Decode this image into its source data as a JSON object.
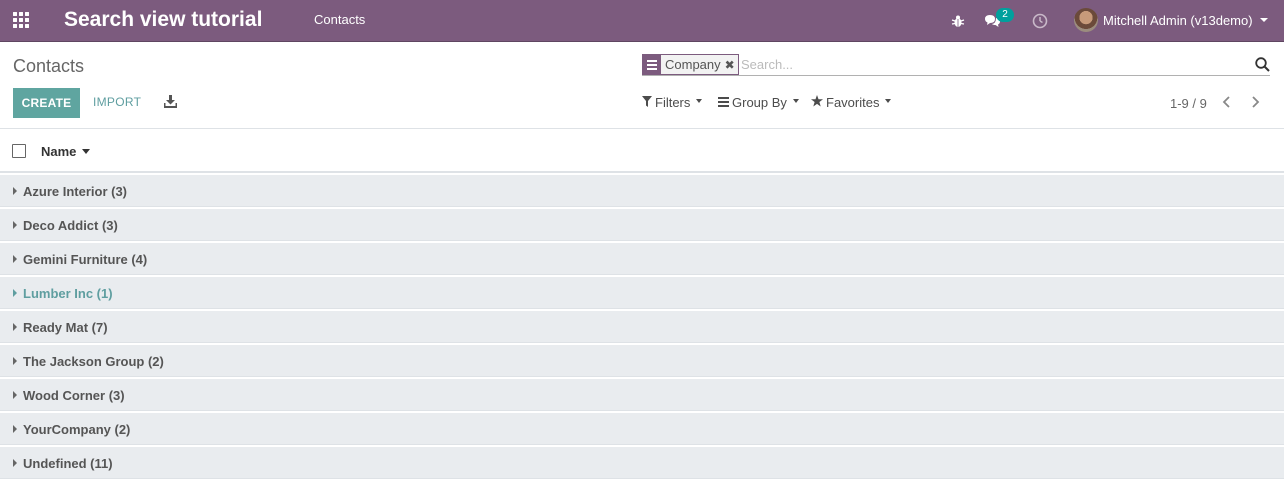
{
  "navbar": {
    "app_title": "Search view tutorial",
    "menu_item": "Contacts",
    "chat_badge": "2",
    "user_name": "Mitchell Admin (v13demo)"
  },
  "control_panel": {
    "breadcrumb": "Contacts",
    "search": {
      "facet_value": "Company",
      "placeholder": "Search..."
    },
    "create_label": "CREATE",
    "import_label": "IMPORT",
    "filters_label": "Filters",
    "groupby_label": "Group By",
    "favorites_label": "Favorites",
    "pager": "1-9 / 9"
  },
  "list": {
    "column_name": "Name",
    "groups": [
      {
        "label": "Azure Interior (3)"
      },
      {
        "label": "Deco Addict (3)"
      },
      {
        "label": "Gemini Furniture (4)"
      },
      {
        "label": "Lumber Inc (1)"
      },
      {
        "label": "Ready Mat (7)"
      },
      {
        "label": "The Jackson Group (2)"
      },
      {
        "label": "Wood Corner (3)"
      },
      {
        "label": "YourCompany (2)"
      },
      {
        "label": "Undefined (11)"
      }
    ]
  },
  "colors": {
    "navbar": "#7c5b7e",
    "primary_button": "#5fa5a0",
    "badge": "#00a09d",
    "group_row_bg": "#e9ecef",
    "hover_text": "#5f9ea0"
  },
  "icons": {
    "apps": "grid-icon",
    "debug": "bug-icon",
    "messages": "chat-bubbles-icon",
    "activities": "clock-icon",
    "search": "magnifier-icon",
    "download": "download-icon",
    "filters": "funnel-icon",
    "groupby": "list-bars-icon",
    "favorites": "star-icon"
  }
}
